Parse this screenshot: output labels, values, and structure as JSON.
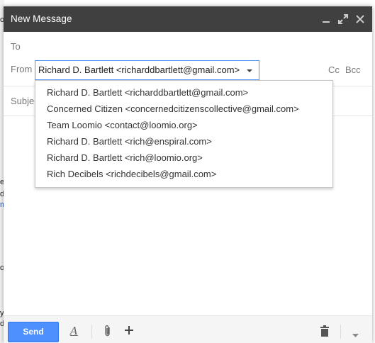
{
  "compose": {
    "title": "New Message",
    "to_label": "To",
    "from_label": "From",
    "from_value": "Richard D. Bartlett <richarddbartlett@gmail.com>",
    "cc_label": "Cc",
    "bcc_label": "Bcc",
    "subject_label": "Subject"
  },
  "from_options": [
    "Richard D. Bartlett <richarddbartlett@gmail.com>",
    "Concerned Citizen <concernedcitizenscollective@gmail.com>",
    "Team Loomio <contact@loomio.org>",
    "Richard D. Bartlett <rich@enspiral.com>",
    "Richard D. Bartlett <rich@loomio.org>",
    "Rich Decibels <richdecibels@gmail.com>"
  ],
  "footer": {
    "send_label": "Send",
    "format_label": "A"
  },
  "background_fragments": [
    "o",
    "es",
    "d",
    "m",
    "o",
    "y",
    "d"
  ],
  "colors": {
    "titlebar": "#404040",
    "send_button": "#4d90fe",
    "select_border": "#4d90fe"
  },
  "icons": [
    "minimize-icon",
    "fullscreen-icon",
    "close-icon",
    "dropdown-caret-icon",
    "formatting-icon",
    "attach-icon",
    "insert-plus-icon",
    "trash-icon",
    "more-options-icon"
  ]
}
